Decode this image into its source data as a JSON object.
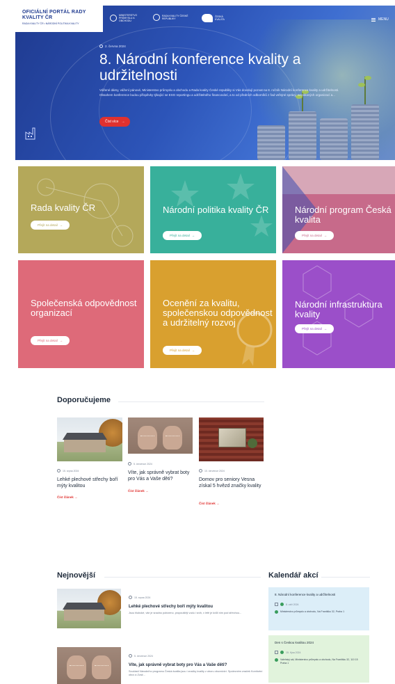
{
  "header": {
    "logo_title": "OFICIÁLNÍ PORTÁL RADY KVALITY ČR",
    "logo_subtitle": "RADA KVALITY ČR • NÁRODNÍ POLITIKA KVALITY",
    "partners": [
      "MINISTERSTVO PRŮMYSLU A OBCHODU",
      "RADA KVALITY ČESKÉ REPUBLIKY",
      "ČESKÁ KVALITA"
    ],
    "menu_label": "MENU"
  },
  "hero": {
    "date": "2. června 2024",
    "title": "8. Národní konference kvality a udržitelnosti",
    "text": "Vážené dámy, vážení pánové, Ministerstvo průmyslu a obchodu a Rada kvality České republiky si Vás dovolují pozvat na 8. ročník Národní konference kvality a udržitelnosti. Obsahem konference budou příspěvky týkající se ESG reportingu a udržitelného financování, a to od předních odborníků z řad veřejné správy, neziskových organizací a...",
    "button": "Číst více"
  },
  "tiles": [
    {
      "title": "Rada kvality ČR",
      "button": "Přejít na detail",
      "color": "#b4a85a"
    },
    {
      "title": "Národní politika kvality ČR",
      "button": "Přejít na detail",
      "color": "#38b09b"
    },
    {
      "title": "Národní program Česká kvalita",
      "button": "Přejít na detail",
      "color": "#c76a8a"
    },
    {
      "title": "Společenská odpovědnost organizací",
      "button": "Přejít na detail",
      "color": "#de6a79"
    },
    {
      "title": "Ocenění za kvalitu, společenskou odpovědnost a udržitelný rozvoj",
      "button": "Přejít na detail",
      "color": "#d9a02f"
    },
    {
      "title": "Národní infrastruktura kvality",
      "button": "Přejít na detail",
      "color": "#9b4fc9"
    }
  ],
  "recommended": {
    "heading": "Doporučujeme",
    "items": [
      {
        "date": "15. srpna 2024",
        "title": "Lehké plechové střechy boří mýty kvalitou",
        "link": "Číst článek"
      },
      {
        "date": "5. července 2024",
        "title": "Víte, jak správně vybrat boty pro Vás a Vaše děti?",
        "link": "Číst článek"
      },
      {
        "date": "10. července 2024",
        "title": "Domov pro seniory Vesna získal 5 hvězd značky kvality",
        "link": "Číst článek"
      }
    ]
  },
  "latest": {
    "heading": "Nejnovější",
    "items": [
      {
        "date": "15. srpna 2024",
        "title": "Lehké plechové střechy boří mýty kvalitou",
        "text": "Jsou hluboké, vše je snadno pobízeno, propouštějí vodu i sníh, v létě je kvůli nim pod střechou..."
      },
      {
        "date": "5. července 2024",
        "title": "Víte, jak správně vybrat boty pro Vás a Vaše děti?",
        "text": "Součástí Národního programu Česká kvalita jsou i značky kvality z oboru obuvnictví. Spolecném značek Komfortní obuv a Zvaž..."
      }
    ]
  },
  "calendar": {
    "heading": "Kalendář akcí",
    "events": [
      {
        "title": "8. Národní konference kvality a udržitelnosti",
        "date": "8. září 2024",
        "place": "Ministerstvo průmyslu a obchodu, Na Františku 32, Praha 1",
        "bg": "#dceef8"
      },
      {
        "title": "Den s Českou kvalitou 2024",
        "date": "15. října 2024",
        "place": "Valeňský sál, Ministerstvo průmyslu a obchodu, Na Františku 32, 110 15 Praha 1",
        "bg": "#e1f3dc"
      }
    ]
  }
}
